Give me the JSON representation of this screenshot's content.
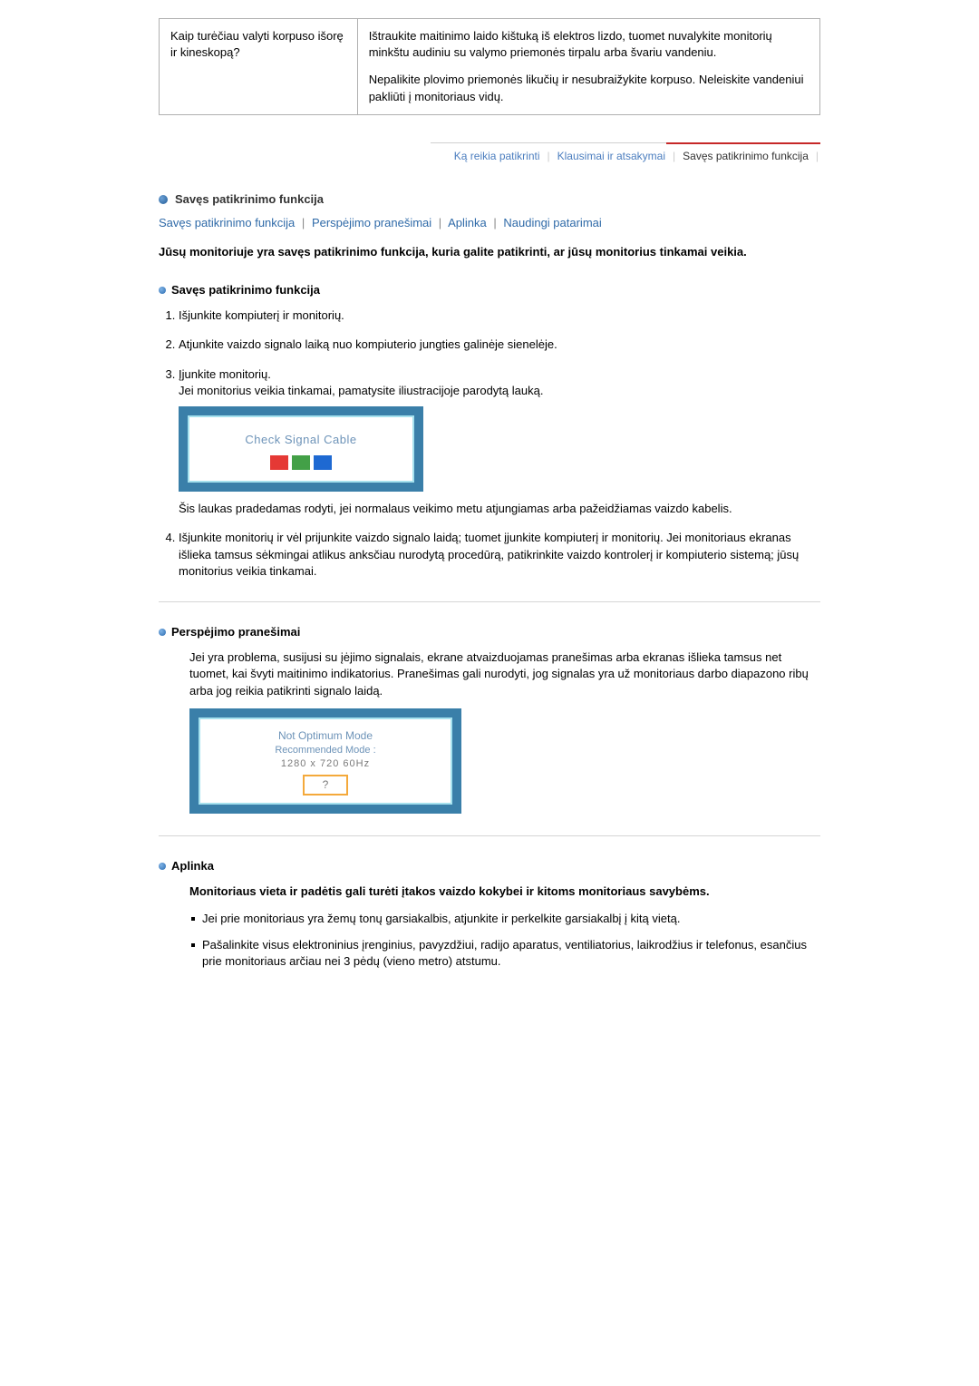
{
  "top_table": {
    "question": "Kaip turėčiau valyti korpuso išorę ir kineskopą?",
    "answer_p1": "Ištraukite maitinimo laido kištuką iš elektros lizdo, tuomet nuvalykite monitorių minkštu audiniu su valymo priemonės tirpalu arba švariu vandeniu.",
    "answer_p2": "Nepalikite plovimo priemonės likučių ir nesubraižykite korpuso. Neleiskite vandeniui pakliūti į monitoriaus vidų."
  },
  "tabs": {
    "t1": "Ką reikia patikrinti",
    "t2": "Klausimai ir atsakymai",
    "t3": "Savęs patikrinimo funkcija"
  },
  "main_title": "Savęs patikrinimo funkcija",
  "anchors": {
    "a1": "Savęs patikrinimo funkcija",
    "a2": "Perspėjimo pranešimai",
    "a3": "Aplinka",
    "a4": "Naudingi patarimai"
  },
  "intro_bold": "Jūsų monitoriuje yra savęs patikrinimo funkcija, kuria galite patikrinti, ar jūsų monitorius tinkamai veikia.",
  "sec1": {
    "heading": "Savęs patikrinimo funkcija",
    "li1": "Išjunkite kompiuterį ir monitorių.",
    "li2": "Atjunkite vaizdo signalo laiką nuo kompiuterio jungties galinėje sienelėje.",
    "li3a": "Įjunkite monitorių.",
    "li3b": "Jei monitorius veikia tinkamai, pamatysite iliustracijoje parodytą lauką.",
    "img1_text": "Check Signal Cable",
    "li3c": "Šis laukas pradedamas rodyti, jei normalaus veikimo metu atjungiamas arba pažeidžiamas vaizdo kabelis.",
    "li4": "Išjunkite monitorių ir vėl prijunkite vaizdo signalo laidą; tuomet įjunkite kompiuterį ir monitorių. Jei monitoriaus ekranas išlieka tamsus sėkmingai atlikus anksčiau nurodytą procedūrą, patikrinkite vaizdo kontrolerį ir kompiuterio sistemą; jūsų monitorius veikia tinkamai."
  },
  "sec2": {
    "heading": "Perspėjimo pranešimai",
    "para": "Jei yra problema, susijusi su įėjimo signalais, ekrane atvaizduojamas pranešimas arba ekranas išlieka tamsus net tuomet, kai švyti maitinimo indikatorius. Pranešimas gali nurodyti, jog signalas yra už monitoriaus darbo diapazono ribų arba jog reikia patikrinti signalo laidą.",
    "img_l1": "Not Optimum Mode",
    "img_l2": "Recommended Mode :",
    "img_l3": "1280 x 720    60Hz",
    "img_q": "?"
  },
  "sec3": {
    "heading": "Aplinka",
    "bold": "Monitoriaus vieta ir padėtis gali turėti įtakos vaizdo kokybei ir kitoms monitoriaus savybėms.",
    "li1": "Jei prie monitoriaus yra žemų tonų garsiakalbis, atjunkite ir perkelkite garsiakalbį į kitą vietą.",
    "li2": "Pašalinkite visus elektroninius įrenginius, pavyzdžiui, radijo aparatus, ventiliatorius, laikrodžius ir telefonus, esančius prie monitoriaus arčiau nei 3 pėdų (vieno metro) atstumu."
  }
}
